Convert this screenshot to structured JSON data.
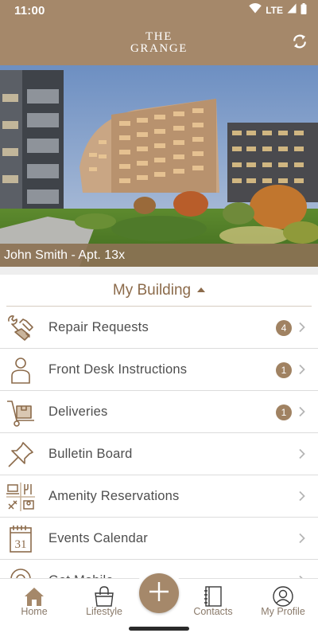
{
  "status_bar": {
    "time": "11:00",
    "network": "LTE",
    "icons": [
      "wifi-icon",
      "signal-icon",
      "battery-icon"
    ]
  },
  "app_bar": {
    "brand_line1": "THE",
    "brand_line2": "GRANGE",
    "refresh_icon": "refresh-icon"
  },
  "hero": {
    "image_description": "photo",
    "resident_label": "John Smith - Apt. 13x"
  },
  "section": {
    "title": "My Building",
    "state_icon": "caret-up-icon"
  },
  "menu": [
    {
      "label": "Repair Requests",
      "icon": "repair-tools-icon",
      "badge": "4"
    },
    {
      "label": "Front Desk Instructions",
      "icon": "person-icon",
      "badge": "1"
    },
    {
      "label": "Deliveries",
      "icon": "hand-truck-icon",
      "badge": "1"
    },
    {
      "label": "Bulletin Board",
      "icon": "pushpin-icon",
      "badge": ""
    },
    {
      "label": "Amenity Reservations",
      "icon": "amenities-icon",
      "badge": ""
    },
    {
      "label": "Events Calendar",
      "icon": "calendar-icon",
      "badge": "",
      "calendar_day": "31"
    },
    {
      "label": "Get Mobile",
      "icon": "location-icon",
      "badge": ""
    }
  ],
  "bottom_nav": {
    "items": [
      {
        "label": "Home",
        "icon": "home-icon"
      },
      {
        "label": "Lifestyle",
        "icon": "shopping-bag-icon"
      },
      {
        "label": "Contacts",
        "icon": "address-book-icon"
      },
      {
        "label": "My Profile",
        "icon": "profile-icon"
      }
    ],
    "fab_icon": "plus-icon"
  },
  "colors": {
    "brand": "#a5886a",
    "accent_text": "#8c6b4b",
    "badge": "#a08262",
    "label_text": "#4e4e4e",
    "chevron": "#b5b5b5"
  }
}
